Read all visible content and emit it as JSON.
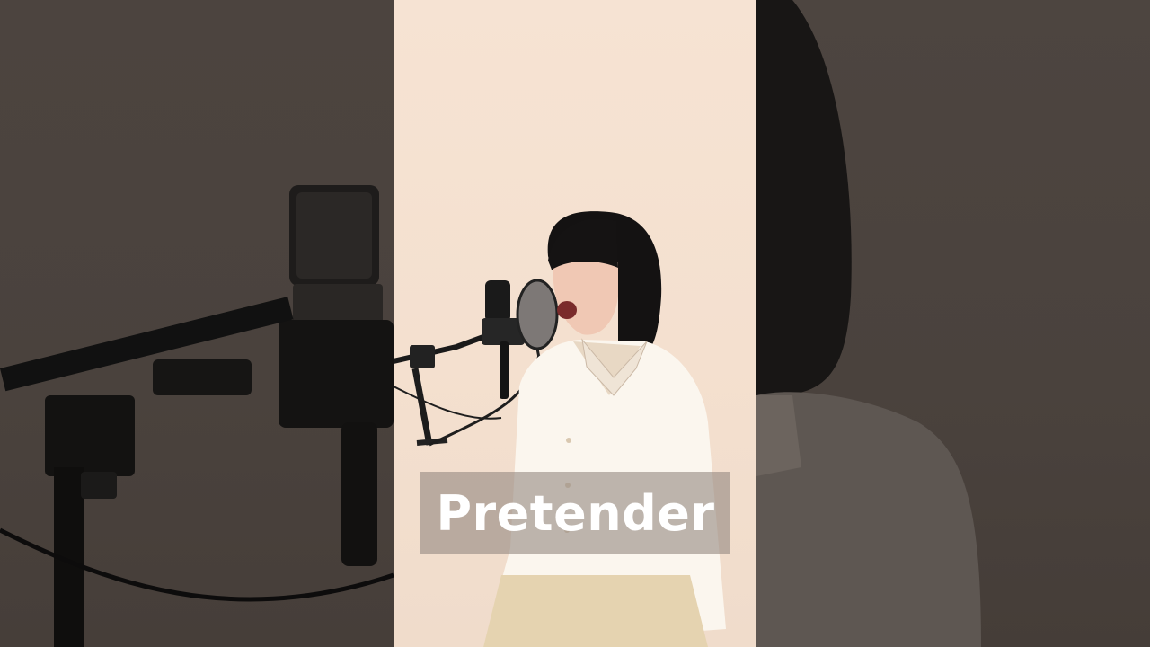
{
  "video": {
    "caption": "Pretender"
  },
  "colors": {
    "backdrop": "#f5e1d1",
    "side_panel": "#4a423d",
    "caption_box": "#968a82",
    "caption_text": "#ffffff"
  },
  "icons": {
    "microphone": "microphone-icon",
    "pop_filter": "pop-filter-icon"
  }
}
